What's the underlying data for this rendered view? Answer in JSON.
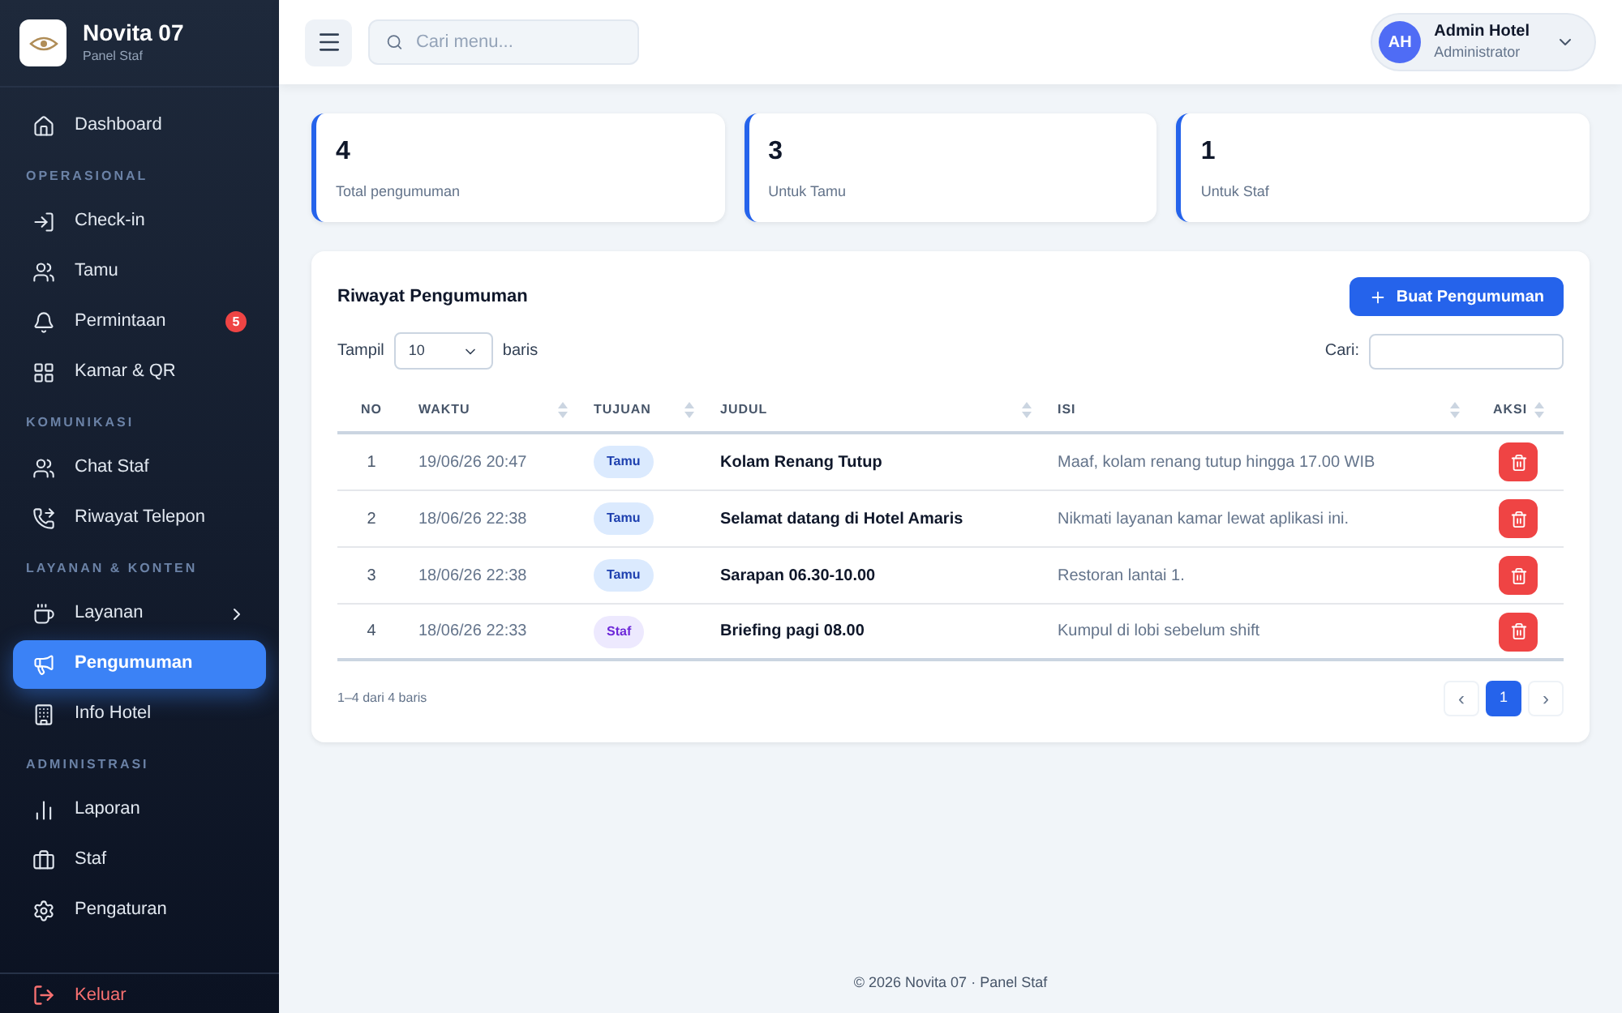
{
  "sidebar": {
    "brand": {
      "name": "Novita 07",
      "subtitle": "Panel Staf"
    },
    "sections": [
      {
        "items": [
          {
            "label": "Dashboard",
            "selected": false,
            "submenu": false
          }
        ]
      },
      {
        "label": "OPERASIONAL",
        "items": [
          {
            "label": "Check-in",
            "selected": false,
            "submenu": false
          },
          {
            "label": "Tamu",
            "selected": false,
            "submenu": false
          },
          {
            "label": "Permintaan",
            "selected": false,
            "submenu": false,
            "badge": "5"
          },
          {
            "label": "Kamar & QR",
            "selected": false,
            "submenu": false
          }
        ]
      },
      {
        "label": "KOMUNIKASI",
        "items": [
          {
            "label": "Chat Staf",
            "selected": false,
            "submenu": false
          },
          {
            "label": "Riwayat Telepon",
            "selected": false,
            "submenu": false
          }
        ]
      },
      {
        "label": "LAYANAN & KONTEN",
        "items": [
          {
            "label": "Layanan",
            "selected": false,
            "submenu": true
          },
          {
            "label": "Pengumuman",
            "selected": true,
            "submenu": false
          },
          {
            "label": "Info Hotel",
            "selected": false,
            "submenu": false
          }
        ]
      },
      {
        "label": "ADMINISTRASI",
        "items": [
          {
            "label": "Laporan",
            "selected": false,
            "submenu": false
          },
          {
            "label": "Staf",
            "selected": false,
            "submenu": false
          },
          {
            "label": "Pengaturan",
            "selected": false,
            "submenu": false
          }
        ]
      }
    ],
    "logout": "Keluar"
  },
  "header": {
    "search": {
      "placeholder": "Cari menu..."
    },
    "user": {
      "initials": "AH",
      "name": "Admin Hotel",
      "role": "Administrator"
    }
  },
  "stats": [
    {
      "value": "4",
      "label": "Total pengumuman"
    },
    {
      "value": "3",
      "label": "Untuk Tamu"
    },
    {
      "value": "1",
      "label": "Untuk Staf"
    }
  ],
  "table_card": {
    "title": "Riwayat Pengumuman",
    "create_button": "Buat Pengumuman",
    "show_label": "Tampil",
    "page_size": "10",
    "rows_label": "baris",
    "search_label": "Cari:",
    "columns": [
      "NO",
      "WAKTU",
      "TUJUAN",
      "JUDUL",
      "ISI",
      "AKSI"
    ],
    "rows": [
      {
        "no": "1",
        "time": "19/06/26 20:47",
        "target": "Tamu",
        "kind": "guest",
        "title": "Kolam Renang Tutup",
        "body": "Maaf, kolam renang tutup hingga 17.00 WIB"
      },
      {
        "no": "2",
        "time": "18/06/26 22:38",
        "target": "Tamu",
        "kind": "guest",
        "title": "Selamat datang di Hotel Amaris",
        "body": "Nikmati layanan kamar lewat aplikasi ini."
      },
      {
        "no": "3",
        "time": "18/06/26 22:38",
        "target": "Tamu",
        "kind": "guest",
        "title": "Sarapan 06.30-10.00",
        "body": "Restoran lantai 1."
      },
      {
        "no": "4",
        "time": "18/06/26 22:33",
        "target": "Staf",
        "kind": "staff",
        "title": "Briefing pagi 08.00",
        "body": "Kumpul di lobi sebelum shift"
      }
    ],
    "info": "1–4 dari 4 baris",
    "pagination": {
      "prev": "‹",
      "pages": [
        {
          "label": "1",
          "selected": true
        }
      ],
      "next": "›"
    }
  },
  "footer": "© 2026 Novita 07 · Panel Staf"
}
